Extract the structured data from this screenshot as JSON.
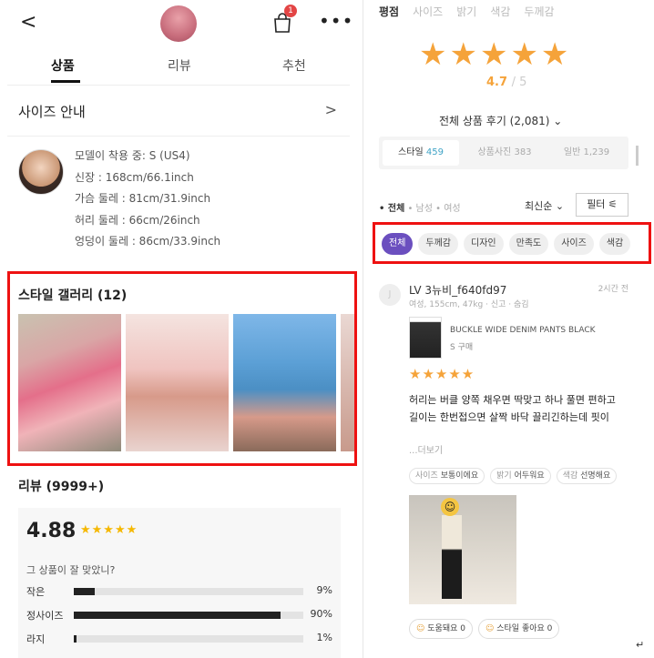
{
  "left": {
    "header": {
      "back": "<",
      "cart_badge": "1",
      "more": "•••"
    },
    "tabs": [
      {
        "label": "상품"
      },
      {
        "label": "리뷰"
      },
      {
        "label": "추천"
      }
    ],
    "size_guide": {
      "title": "사이즈 안내",
      "chevron": ">"
    },
    "model": {
      "lines": [
        "모델이 착용 중: S (US4)",
        "신장 : 168cm/66.1inch",
        "가슴 둘레 : 81cm/31.9inch",
        "허리 둘레 : 66cm/26inch",
        "엉덩이 둘레 : 86cm/33.9inch"
      ]
    },
    "gallery": {
      "title": "스타일 갤러리 (12)"
    },
    "review": {
      "title": "리뷰 (9999+)",
      "score": "4.88",
      "stars": "★★★★★",
      "fit_question": "그 상품이 잘 맞았니?",
      "fit": [
        {
          "label": "작은",
          "value": 9,
          "pct": "9%"
        },
        {
          "label": "정사이즈",
          "value": 90,
          "pct": "90%"
        },
        {
          "label": "라지",
          "value": 1,
          "pct": "1%"
        }
      ]
    }
  },
  "right": {
    "top_tabs": [
      "평점",
      "사이즈",
      "밝기",
      "색감",
      "두께감"
    ],
    "big_stars": "★★★★★",
    "avg": "4.7",
    "avg_max": "/ 5",
    "total": "전체 상품 후기 (2,081) ⌄",
    "segments": [
      {
        "label": "스타일",
        "count": "459"
      },
      {
        "label": "상품사진",
        "count": "383"
      },
      {
        "label": "일반",
        "count": "1,239"
      }
    ],
    "genders": {
      "all": "• 전체",
      "male": "• 남성",
      "female": "• 여성"
    },
    "sort": "최신순 ⌄",
    "filter": "필터 ⚟",
    "chips": [
      "전체",
      "두께감",
      "디자인",
      "만족도",
      "사이즈",
      "색감"
    ],
    "review": {
      "avatar": "J",
      "name": "LV 3뉴비_f640fd97",
      "time": "2시간 전",
      "meta": "여성, 155cm, 47kg · 신고 · 숨김",
      "product": "BUCKLE WIDE DENIM PANTS BLACK",
      "size": "S 구매",
      "stars": "★★★★★",
      "text1": "허리는 버클 양쪽 채우면 딱맞고 하나 풀면 편하고",
      "text2": "길이는 한번접으면 살짝 바닥 끌리긴하는데 핏이",
      "more": "...더보기",
      "tags": [
        {
          "k": "사이즈",
          "v": "보통이에요"
        },
        {
          "k": "밝기",
          "v": "어두워요"
        },
        {
          "k": "색감",
          "v": "선명해요"
        }
      ],
      "likes": [
        "도움돼요 0",
        "스타일 좋아요 0"
      ]
    },
    "cursor_glyph": "↵"
  }
}
